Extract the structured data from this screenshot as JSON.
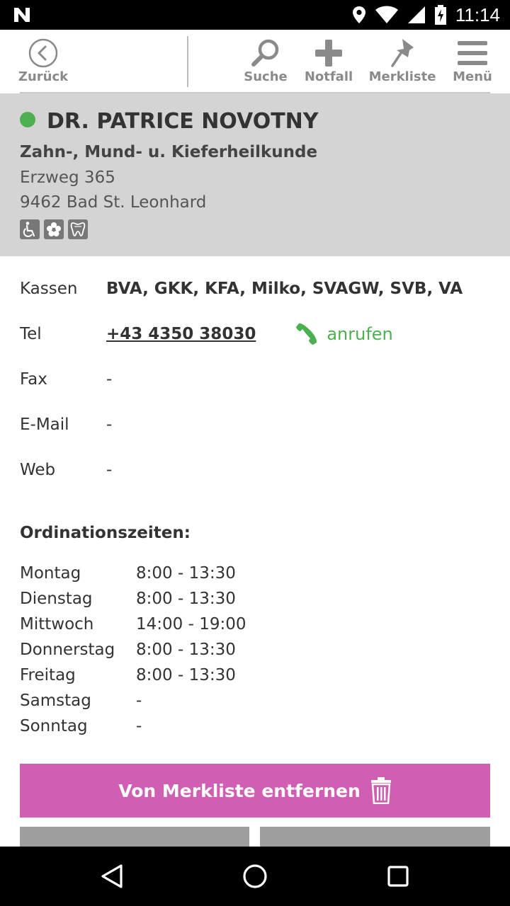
{
  "statusbar": {
    "time": "11:14",
    "icons": [
      "n-logo-icon",
      "location-icon",
      "wifi-icon",
      "signal-icon",
      "battery-charging-icon"
    ]
  },
  "toolbar": {
    "back_label": "Zurück",
    "search_label": "Suche",
    "emergency_label": "Notfall",
    "bookmarks_label": "Merkliste",
    "menu_label": "Menü"
  },
  "doctor": {
    "name": "DR. PATRICE NOVOTNY",
    "specialty": "Zahn-, Mund- u. Kieferheilkunde",
    "street": "Erzweg 365",
    "city": "9462 Bad St. Leonhard",
    "status_color": "#4caf50",
    "badges": [
      "wheelchair-icon",
      "flower-icon",
      "tooth-icon"
    ]
  },
  "contact": {
    "kassen_label": "Kassen",
    "kassen_value": "BVA, GKK, KFA, Milko, SVAGW, SVB, VA",
    "tel_label": "Tel",
    "tel_value": "+43 4350 38030",
    "call_label": "anrufen",
    "fax_label": "Fax",
    "fax_value": "-",
    "email_label": "E-Mail",
    "email_value": "-",
    "web_label": "Web",
    "web_value": "-"
  },
  "hours": {
    "title": "Ordinationszeiten:",
    "days": [
      {
        "day": "Montag",
        "time": "8:00 - 13:30"
      },
      {
        "day": "Dienstag",
        "time": "8:00 - 13:30"
      },
      {
        "day": "Mittwoch",
        "time": "14:00 - 19:00"
      },
      {
        "day": "Donnerstag",
        "time": "8:00 - 13:30"
      },
      {
        "day": "Freitag",
        "time": "8:00 - 13:30"
      },
      {
        "day": "Samstag",
        "time": "-"
      },
      {
        "day": "Sonntag",
        "time": "-"
      }
    ]
  },
  "actions": {
    "remove_label": "Von Merkliste entfernen",
    "accent_color": "#d05fb3"
  }
}
